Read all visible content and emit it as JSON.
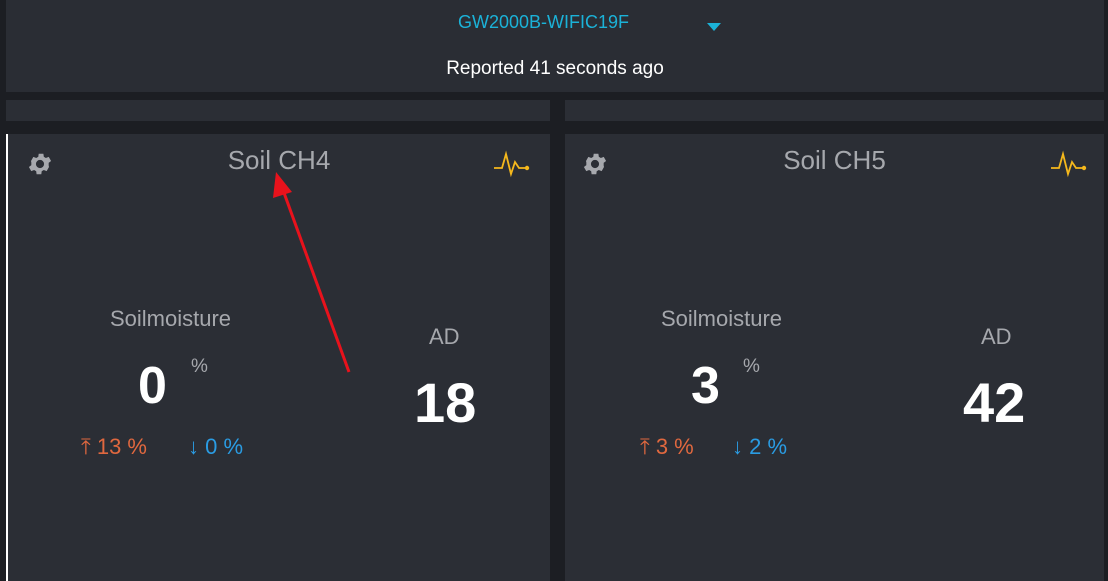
{
  "header": {
    "device_name": "GW2000B-WIFIC19F",
    "reported": "Reported 41 seconds ago"
  },
  "cards": [
    {
      "title": "Soil CH4",
      "moisture_label": "Soilmoisture",
      "moisture_value": "0",
      "moisture_unit": "%",
      "high": "⤒ 13 %",
      "low": "↓ 0 %",
      "ad_label": "AD",
      "ad_value": "18"
    },
    {
      "title": "Soil CH5",
      "moisture_label": "Soilmoisture",
      "moisture_value": "3",
      "moisture_unit": "%",
      "high": "⤒ 3 %",
      "low": "↓ 2 %",
      "ad_label": "AD",
      "ad_value": "42"
    }
  ],
  "icons": {
    "settings": "gear-icon",
    "chart": "pulse-chart-icon",
    "dropdown": "caret-down-icon"
  },
  "colors": {
    "accent_cyan": "#1bb2d8",
    "high_orange": "#e0683f",
    "low_blue": "#2a9ce3",
    "chart_icon_yellow": "#f5b81c",
    "annotation_red": "#e8121c",
    "panel_bg": "#2b2e35"
  }
}
